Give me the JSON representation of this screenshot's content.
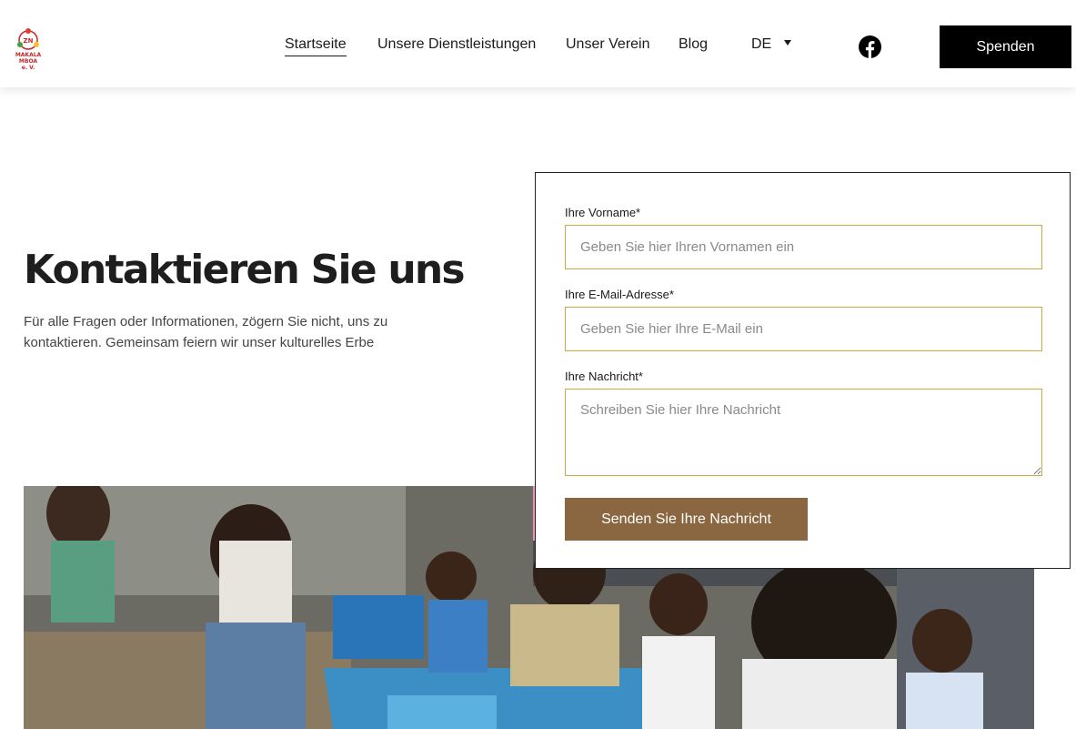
{
  "header": {
    "logo": {
      "badge": "ZN",
      "line1": "MAKALA MBOA",
      "line2": "e. V."
    },
    "nav": [
      "Startseite",
      "Unsere Dienstleistungen",
      "Unser Verein",
      "Blog"
    ],
    "active_nav": "Startseite",
    "language": "DE",
    "social_icon": "facebook-icon",
    "donate_label": "Spenden"
  },
  "hero": {
    "title": "Kontaktieren Sie uns",
    "description": "Für alle Fragen oder Informationen, zögern Sie nicht, uns zu kontaktieren. Gemeinsam feiern wir unser kulturelles Erbe"
  },
  "form": {
    "first_name": {
      "label": "Ihre Vorname*",
      "placeholder": "Geben Sie hier Ihren Vornamen ein",
      "value": ""
    },
    "email": {
      "label": "Ihre E-Mail-Adresse*",
      "placeholder": "Geben Sie hier Ihre E-Mail ein",
      "value": ""
    },
    "message": {
      "label": "Ihre Nachricht*",
      "placeholder": "Schreiben Sie hier Ihre Nachricht",
      "value": ""
    },
    "submit_label": "Senden Sie Ihre Nachricht"
  },
  "colors": {
    "donate_bg": "#000000",
    "submit_bg": "#8a6641",
    "field_border": "#c9a944",
    "logo_accent": "#c62828"
  }
}
